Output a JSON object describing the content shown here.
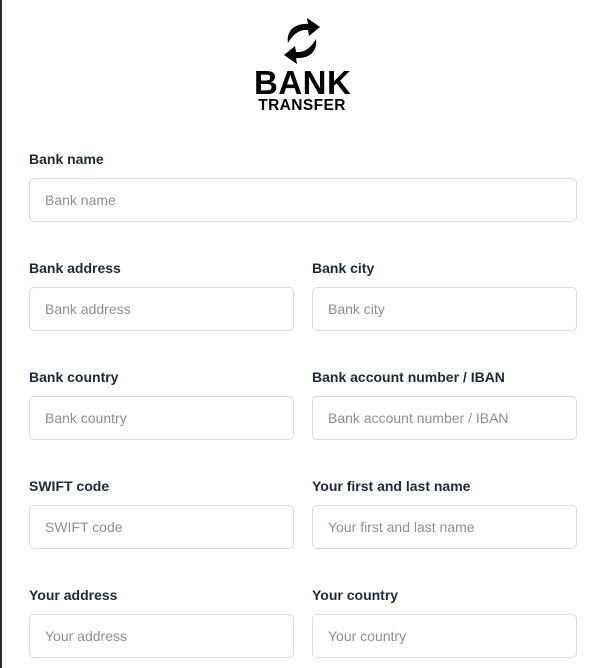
{
  "logo": {
    "icon": "circular-arrows-icon",
    "line1": "BANK",
    "line2": "TRANSFER"
  },
  "form": {
    "bank_name": {
      "label": "Bank name",
      "placeholder": "Bank name",
      "value": ""
    },
    "bank_address": {
      "label": "Bank address",
      "placeholder": "Bank address",
      "value": ""
    },
    "bank_city": {
      "label": "Bank city",
      "placeholder": "Bank city",
      "value": ""
    },
    "bank_country": {
      "label": "Bank country",
      "placeholder": "Bank country",
      "value": ""
    },
    "account_number": {
      "label": "Bank account number / IBAN",
      "placeholder": "Bank account number / IBAN",
      "value": ""
    },
    "swift_code": {
      "label": "SWIFT code",
      "placeholder": "SWIFT code",
      "value": ""
    },
    "full_name": {
      "label": "Your first and last name",
      "placeholder": "Your first and last name",
      "value": ""
    },
    "your_address": {
      "label": "Your address",
      "placeholder": "Your address",
      "value": ""
    },
    "your_country": {
      "label": "Your country",
      "placeholder": "Your country",
      "value": ""
    }
  },
  "colors": {
    "label": "#1f2a37",
    "placeholder": "#8a9099",
    "input_border": "#d9dde3",
    "logo": "#000000"
  }
}
